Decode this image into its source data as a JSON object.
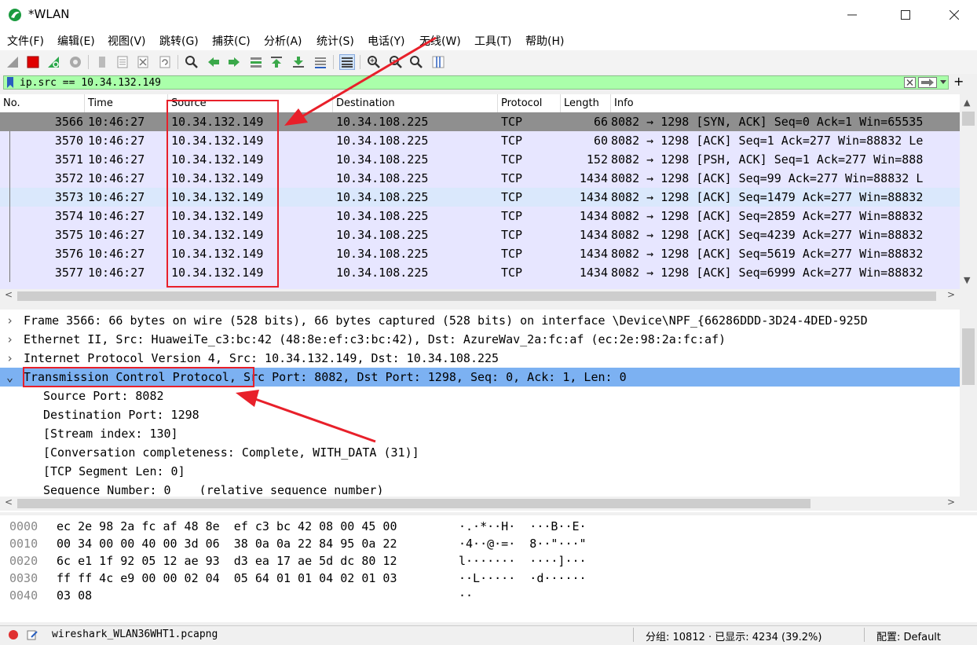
{
  "window": {
    "title": "*WLAN"
  },
  "menu": [
    {
      "label": "文件(F)"
    },
    {
      "label": "编辑(E)"
    },
    {
      "label": "视图(V)"
    },
    {
      "label": "跳转(G)"
    },
    {
      "label": "捕获(C)"
    },
    {
      "label": "分析(A)"
    },
    {
      "label": "统计(S)"
    },
    {
      "label": "电话(Y)"
    },
    {
      "label": "无线(W)"
    },
    {
      "label": "工具(T)"
    },
    {
      "label": "帮助(H)"
    }
  ],
  "toolbar": {
    "icons": [
      "shark-fin-icon",
      "stop-icon",
      "restart-icon",
      "options-icon",
      "open-icon",
      "file-icon",
      "close-file-icon",
      "reload-icon",
      "find-icon",
      "back-arrow-icon",
      "forward-arrow-icon",
      "goto-packet-icon",
      "first-packet-icon",
      "last-packet-icon",
      "autoscroll-icon",
      "colorize-icon",
      "zoom-in-icon",
      "zoom-out-icon",
      "zoom-normal-icon",
      "resize-columns-icon"
    ]
  },
  "filter": {
    "value": "ip.src == 10.34.132.149"
  },
  "packet_list": {
    "headers": [
      "No.",
      "Time",
      "Source",
      "Destination",
      "Protocol",
      "Length",
      "Info"
    ],
    "rows": [
      {
        "no": "3566",
        "time": "10:46:27",
        "src": "10.34.132.149",
        "dst": "10.34.108.225",
        "proto": "TCP",
        "len": "66",
        "info": "8082 → 1298 [SYN, ACK] Seq=0 Ack=1 Win=65535"
      },
      {
        "no": "3570",
        "time": "10:46:27",
        "src": "10.34.132.149",
        "dst": "10.34.108.225",
        "proto": "TCP",
        "len": "60",
        "info": "8082 → 1298 [ACK] Seq=1 Ack=277 Win=88832 Le"
      },
      {
        "no": "3571",
        "time": "10:46:27",
        "src": "10.34.132.149",
        "dst": "10.34.108.225",
        "proto": "TCP",
        "len": "152",
        "info": "8082 → 1298 [PSH, ACK] Seq=1 Ack=277 Win=888"
      },
      {
        "no": "3572",
        "time": "10:46:27",
        "src": "10.34.132.149",
        "dst": "10.34.108.225",
        "proto": "TCP",
        "len": "1434",
        "info": "8082 → 1298 [ACK] Seq=99 Ack=277 Win=88832 L"
      },
      {
        "no": "3573",
        "time": "10:46:27",
        "src": "10.34.132.149",
        "dst": "10.34.108.225",
        "proto": "TCP",
        "len": "1434",
        "info": "8082 → 1298 [ACK] Seq=1479 Ack=277 Win=88832"
      },
      {
        "no": "3574",
        "time": "10:46:27",
        "src": "10.34.132.149",
        "dst": "10.34.108.225",
        "proto": "TCP",
        "len": "1434",
        "info": "8082 → 1298 [ACK] Seq=2859 Ack=277 Win=88832"
      },
      {
        "no": "3575",
        "time": "10:46:27",
        "src": "10.34.132.149",
        "dst": "10.34.108.225",
        "proto": "TCP",
        "len": "1434",
        "info": "8082 → 1298 [ACK] Seq=4239 Ack=277 Win=88832"
      },
      {
        "no": "3576",
        "time": "10:46:27",
        "src": "10.34.132.149",
        "dst": "10.34.108.225",
        "proto": "TCP",
        "len": "1434",
        "info": "8082 → 1298 [ACK] Seq=5619 Ack=277 Win=88832"
      },
      {
        "no": "3577",
        "time": "10:46:27",
        "src": "10.34.132.149",
        "dst": "10.34.108.225",
        "proto": "TCP",
        "len": "1434",
        "info": "8082 → 1298 [ACK] Seq=6999 Ack=277 Win=88832"
      }
    ]
  },
  "details": {
    "lines": [
      "Frame 3566: 66 bytes on wire (528 bits), 66 bytes captured (528 bits) on interface \\Device\\NPF_{66286DDD-3D24-4DED-925D",
      "Ethernet II, Src: HuaweiTe_c3:bc:42 (48:8e:ef:c3:bc:42), Dst: AzureWav_2a:fc:af (ec:2e:98:2a:fc:af)",
      "Internet Protocol Version 4, Src: 10.34.132.149, Dst: 10.34.108.225",
      "Transmission Control Protocol, Src Port: 8082, Dst Port: 1298, Seq: 0, Ack: 1, Len: 0",
      "Source Port: 8082",
      "Destination Port: 1298",
      "[Stream index: 130]",
      "[Conversation completeness: Complete, WITH_DATA (31)]",
      "[TCP Segment Len: 0]",
      "Sequence Number: 0    (relative sequence number)"
    ]
  },
  "bytes": {
    "rows": [
      {
        "offset": "0000",
        "hex": "ec 2e 98 2a fc af 48 8e  ef c3 bc 42 08 00 45 00",
        "ascii": "·.·*··H·  ···B··E·"
      },
      {
        "offset": "0010",
        "hex": "00 34 00 00 40 00 3d 06  38 0a 0a 22 84 95 0a 22",
        "ascii": "·4··@·=·  8··\"···\""
      },
      {
        "offset": "0020",
        "hex": "6c e1 1f 92 05 12 ae 93  d3 ea 17 ae 5d dc 80 12",
        "ascii": "l·······  ····]···"
      },
      {
        "offset": "0030",
        "hex": "ff ff 4c e9 00 00 02 04  05 64 01 01 04 02 01 03",
        "ascii": "··L·····  ·d······"
      },
      {
        "offset": "0040",
        "hex": "03 08",
        "ascii": "··"
      }
    ]
  },
  "status": {
    "file": "wireshark_WLAN36WHT1.pcapng",
    "packets": "分组: 10812 · 已显示: 4234 (39.2%)",
    "profile": "配置: Default"
  },
  "colors": {
    "selected_row": "#8f8f8f",
    "tcp_row": "#e7e6ff",
    "alt_row": "#dae8fc",
    "highlight": "#7cb1f2",
    "filter_ok": "#aaffaa",
    "annotation": "#e8202a"
  }
}
